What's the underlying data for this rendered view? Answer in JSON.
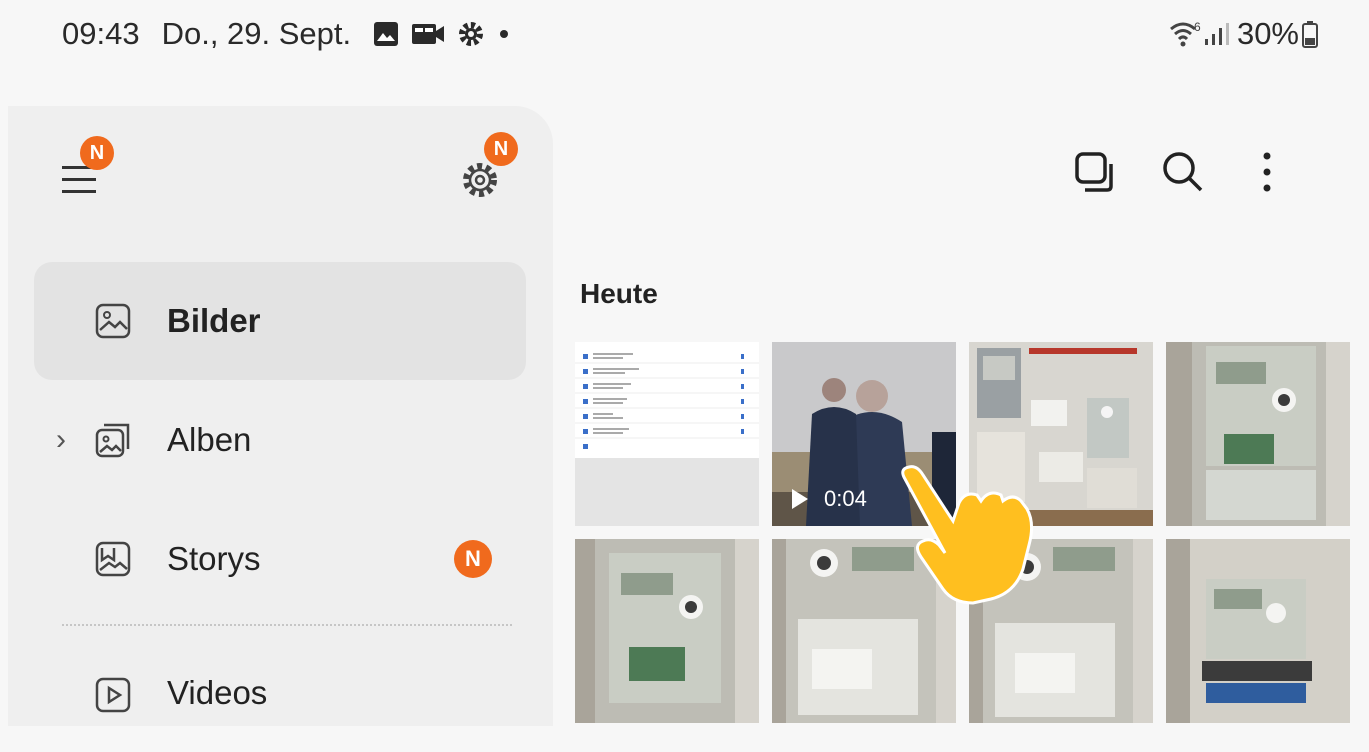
{
  "status_bar": {
    "time": "09:43",
    "date": "Do., 29. Sept.",
    "battery": "30%"
  },
  "drawer": {
    "menu_badge": "N",
    "settings_badge": "N",
    "items": [
      {
        "label": "Bilder",
        "icon": "image-icon",
        "selected": true
      },
      {
        "label": "Alben",
        "icon": "album-icon",
        "expandable": true
      },
      {
        "label": "Storys",
        "icon": "story-icon",
        "badge": "N"
      },
      {
        "label": "Videos",
        "icon": "video-icon"
      }
    ]
  },
  "toolbar": {
    "icons": [
      "select-icon",
      "search-icon",
      "more-icon"
    ]
  },
  "gallery": {
    "section_title": "Heute",
    "video_duration": "0:04"
  },
  "colors": {
    "badge": "#f06a1d",
    "gesture_hand": "#ffbf1f"
  }
}
